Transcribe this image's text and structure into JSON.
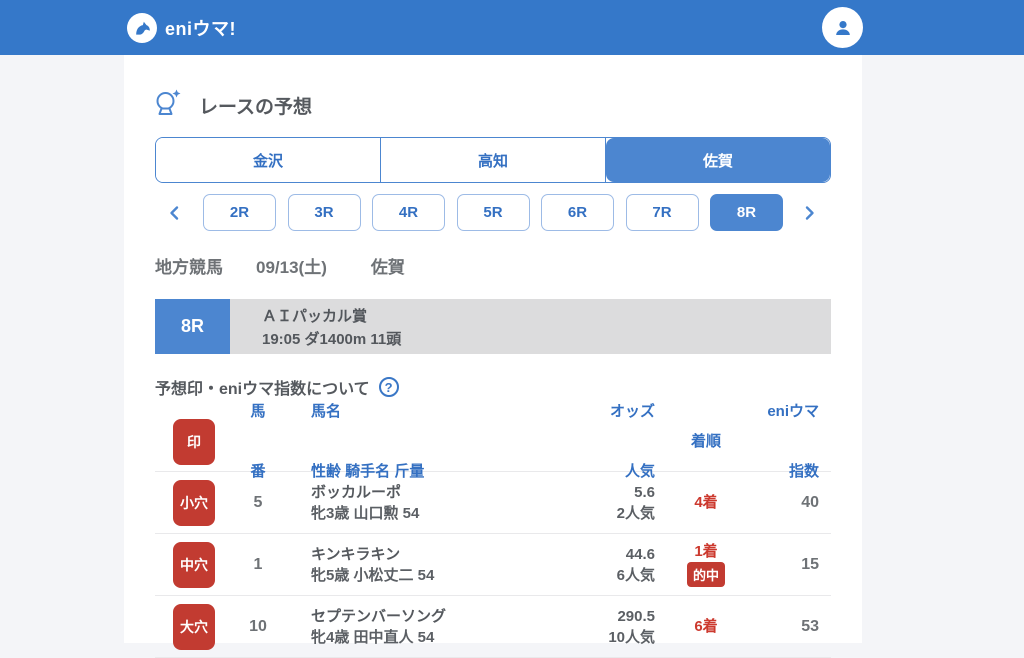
{
  "colors": {
    "header_blue": "#3578c9",
    "accent_blue": "#4c86d0",
    "link_blue": "#3470c2",
    "badge_red": "#c23b31",
    "result_red": "#cc392e",
    "banner_gray": "#dcdcdd",
    "page_bg": "#f4f5f8"
  },
  "header": {
    "logo_text": "eniウマ!"
  },
  "page": {
    "title": "レースの予想"
  },
  "venue_tabs": [
    {
      "label": "金沢",
      "selected": false
    },
    {
      "label": "高知",
      "selected": false
    },
    {
      "label": "佐賀",
      "selected": true
    }
  ],
  "race_nav": {
    "races": [
      {
        "label": "2R",
        "selected": false
      },
      {
        "label": "3R",
        "selected": false
      },
      {
        "label": "4R",
        "selected": false
      },
      {
        "label": "5R",
        "selected": false
      },
      {
        "label": "6R",
        "selected": false
      },
      {
        "label": "7R",
        "selected": false
      },
      {
        "label": "8R",
        "selected": true
      }
    ]
  },
  "meta": {
    "category": "地方競馬",
    "date": "09/13(土)",
    "venue": "佐賀"
  },
  "race_banner": {
    "race_no": "8R",
    "name": "ＡＩパッカル賞",
    "details": "19:05 ダ1400m 11頭"
  },
  "about": {
    "label": "予想印・eniウマ指数について",
    "help_glyph": "?"
  },
  "table": {
    "headers": {
      "mark": "印",
      "no_line1": "馬",
      "no_line2": "番",
      "horse_line1": "馬名",
      "horse_line2": "性齢 騎手名 斤量",
      "odds_line1": "オッズ",
      "odds_line2": "人気",
      "result": "着順",
      "index_line1": "eniウマ",
      "index_line2": "指数"
    },
    "rows": [
      {
        "mark": "小穴",
        "horse_no": "5",
        "name": "ボッカルーポ",
        "profile": "牝3歳 山口勲 54",
        "odds": "5.6",
        "popularity": "2人気",
        "result": "4着",
        "index": "40"
      },
      {
        "mark": "中穴",
        "horse_no": "1",
        "name": "キンキラキン",
        "profile": "牝5歳 小松丈二 54",
        "odds": "44.6",
        "popularity": "6人気",
        "result": "1着",
        "hit_label": "的中",
        "index": "15"
      },
      {
        "mark": "大穴",
        "horse_no": "10",
        "name": "セプテンバーソング",
        "profile": "牝4歳 田中直人 54",
        "odds": "290.5",
        "popularity": "10人気",
        "result": "6着",
        "index": "53"
      }
    ]
  }
}
